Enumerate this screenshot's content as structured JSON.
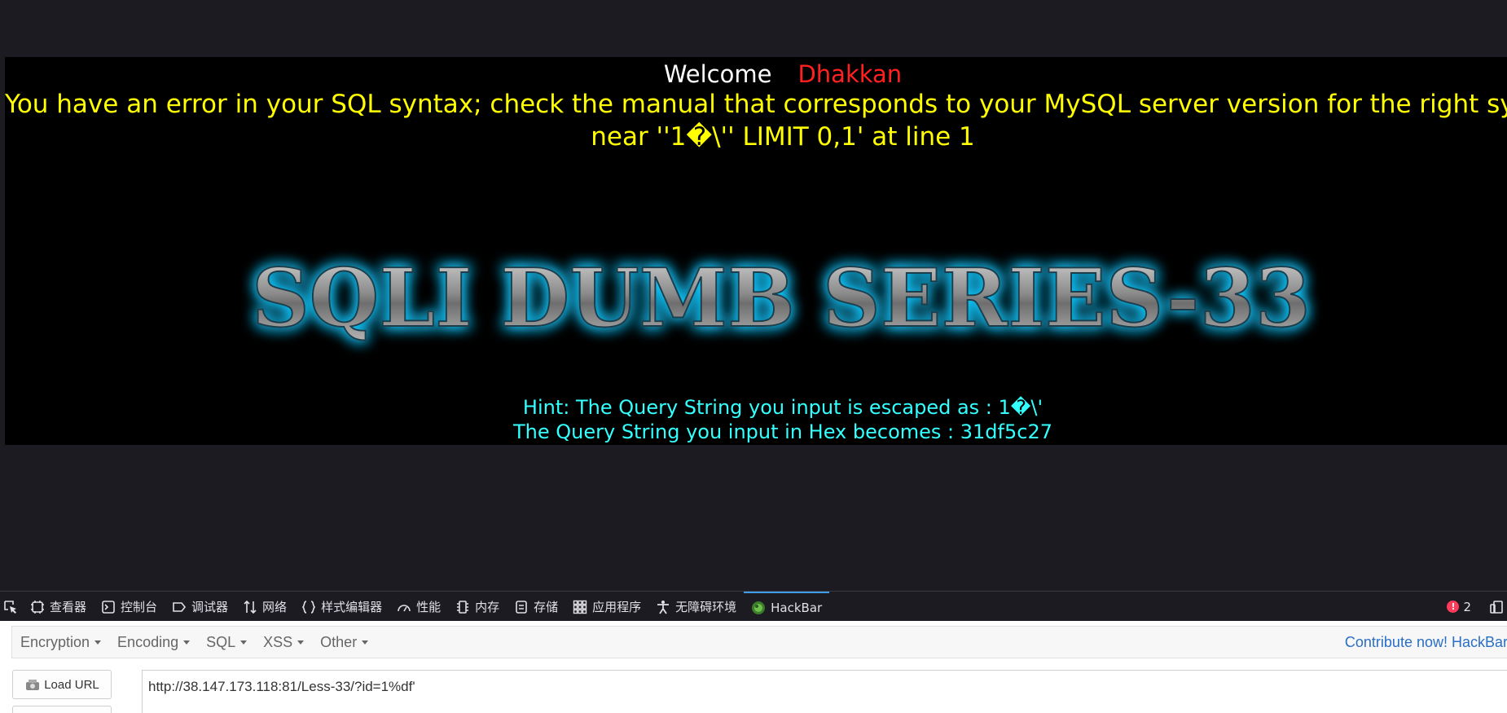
{
  "page": {
    "welcome": "Welcome",
    "user_name": "Dhakkan",
    "error_line1": "You have an error in your SQL syntax; check the manual that corresponds to your MySQL server version for the right syntax to use",
    "error_line2": "near ''1�\\'' LIMIT 0,1' at line 1",
    "banner_text": "SQLI DUMB SERIES-33",
    "hint_line1": "Hint: The Query String you input is escaped as : 1�\\'",
    "hint_line2": "The Query String you input in Hex becomes : 31df5c27"
  },
  "devtools": {
    "tabs": [
      {
        "label": "查看器",
        "icon": "inspector-icon"
      },
      {
        "label": "控制台",
        "icon": "console-icon"
      },
      {
        "label": "调试器",
        "icon": "debugger-icon"
      },
      {
        "label": "网络",
        "icon": "network-icon"
      },
      {
        "label": "样式编辑器",
        "icon": "style-editor-icon"
      },
      {
        "label": "性能",
        "icon": "performance-icon"
      },
      {
        "label": "内存",
        "icon": "memory-icon"
      },
      {
        "label": "存储",
        "icon": "storage-icon"
      },
      {
        "label": "应用程序",
        "icon": "application-icon"
      },
      {
        "label": "无障碍环境",
        "icon": "accessibility-icon"
      },
      {
        "label": "HackBar",
        "icon": "hackbar-icon"
      }
    ],
    "active_tab": "HackBar",
    "error_count": "2",
    "accent_color": "#3f9ce8"
  },
  "hackbar": {
    "menu": [
      "Encryption",
      "Encoding",
      "SQL",
      "XSS",
      "Other"
    ],
    "contribute": "Contribute now! HackBar",
    "load_url_label": "Load URL",
    "url_value": "http://38.147.173.118:81/Less-33/?id=1%df'"
  }
}
